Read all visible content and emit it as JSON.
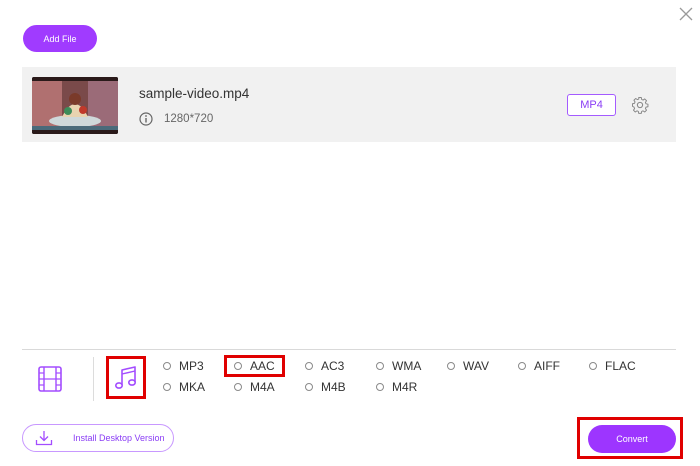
{
  "toolbar": {
    "add_file_label": "Add File"
  },
  "file": {
    "name": "sample-video.mp4",
    "resolution": "1280*720",
    "format": "MP4"
  },
  "tabs": {
    "video": "film-icon",
    "audio": "music-note-icon"
  },
  "formats": {
    "row1": [
      "MP3",
      "AAC",
      "AC3",
      "WMA",
      "WAV",
      "AIFF",
      "FLAC"
    ],
    "row2": [
      "MKA",
      "M4A",
      "M4B",
      "M4R"
    ]
  },
  "footer": {
    "install_label": "Install Desktop Version",
    "convert_label": "Convert"
  },
  "colors": {
    "accent": "#9d35ff",
    "highlight": "#e00000"
  }
}
